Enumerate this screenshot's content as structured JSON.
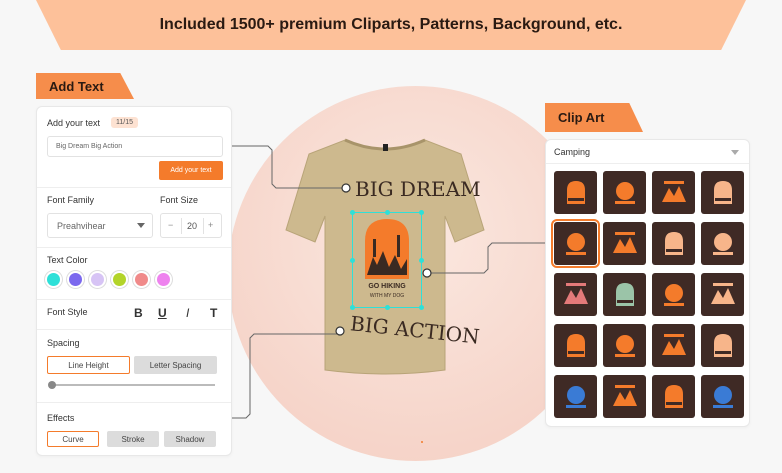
{
  "banner": {
    "text": "Included 1500+ premium Cliparts, Patterns, Background, etc."
  },
  "add_text": {
    "tag": "Add Text",
    "label": "Add your text",
    "count": "11/15",
    "value": "Big Dream Big Action",
    "add_button": "Add your text",
    "font_family_label": "Font Family",
    "font_family_value": "Preahvihear",
    "font_size_label": "Font Size",
    "font_size_value": "20",
    "minus": "−",
    "plus": "+",
    "color_label": "Text Color",
    "colors": [
      "#2ee0d8",
      "#7b68ee",
      "#d7c4f5",
      "#b3d42a",
      "#f08a8a",
      "#ee82ee"
    ],
    "style_label": "Font Style",
    "styles": [
      "B",
      "U",
      "I",
      "T"
    ],
    "spacing_label": "Spacing",
    "line_height": "Line Height",
    "letter_spacing": "Letter Spacing",
    "spacing_slider": 0,
    "effects_label": "Effects",
    "effects": [
      "Curve",
      "Stroke",
      "Shadow"
    ]
  },
  "shirt": {
    "top_text": "BIG DREAM",
    "bottom_text": "BIG ACTION",
    "design_line1": "GO HIKING",
    "design_line2": "WITH MY DOG"
  },
  "clip_art": {
    "tag": "Clip Art",
    "category": "Camping",
    "items": [
      {
        "color": "#f47b2b"
      },
      {
        "color": "#f47b2b"
      },
      {
        "color": "#f47b2b"
      },
      {
        "color": "#f7b58a"
      },
      {
        "color": "#f47b2b"
      },
      {
        "color": "#f47b2b"
      },
      {
        "color": "#f7b58a"
      },
      {
        "color": "#f7b58a"
      },
      {
        "color": "#e47a7a"
      },
      {
        "color": "#9bc4a8"
      },
      {
        "color": "#f47b2b"
      },
      {
        "color": "#f7b58a"
      },
      {
        "color": "#f47b2b"
      },
      {
        "color": "#f47b2b"
      },
      {
        "color": "#f47b2b"
      },
      {
        "color": "#f7b58a"
      },
      {
        "color": "#3a7bd5"
      },
      {
        "color": "#f47b2b"
      },
      {
        "color": "#f47b2b"
      },
      {
        "color": "#3a7bd5"
      }
    ]
  }
}
